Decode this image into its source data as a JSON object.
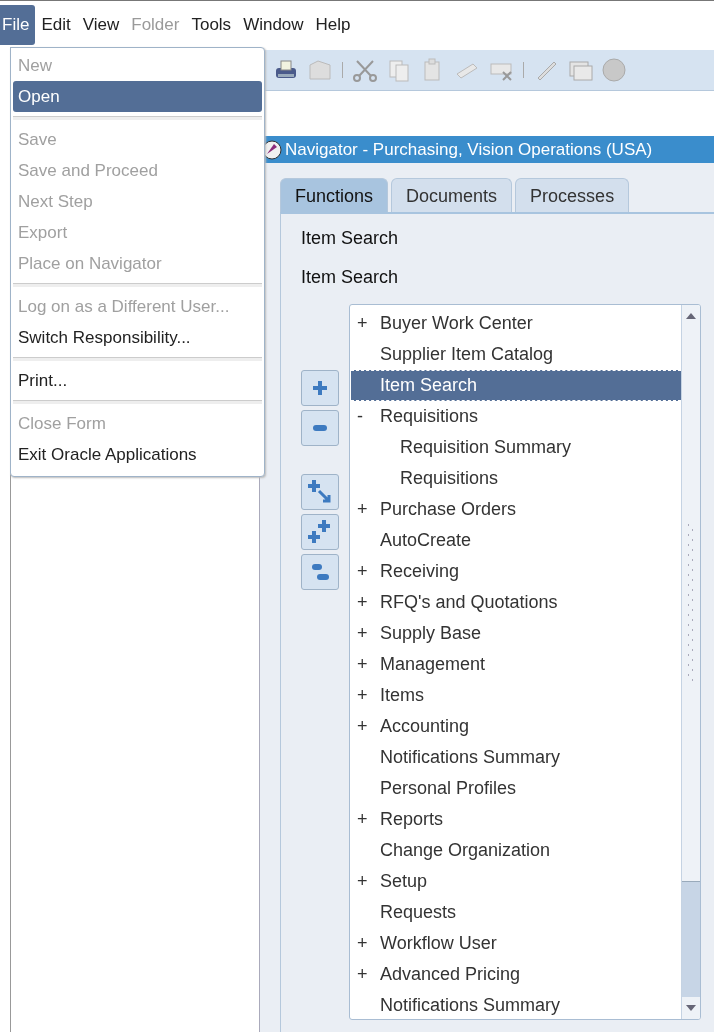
{
  "menubar": [
    {
      "label": "File",
      "selected": true,
      "disabled": false
    },
    {
      "label": "Edit",
      "selected": false,
      "disabled": false
    },
    {
      "label": "View",
      "selected": false,
      "disabled": false
    },
    {
      "label": "Folder",
      "selected": false,
      "disabled": true
    },
    {
      "label": "Tools",
      "selected": false,
      "disabled": false
    },
    {
      "label": "Window",
      "selected": false,
      "disabled": false
    },
    {
      "label": "Help",
      "selected": false,
      "disabled": false
    }
  ],
  "file_menu": {
    "groups": [
      [
        {
          "label": "New",
          "disabled": true,
          "selected": false
        },
        {
          "label": "Open",
          "disabled": false,
          "selected": true
        }
      ],
      [
        {
          "label": "Save",
          "disabled": true,
          "selected": false
        },
        {
          "label": "Save and Proceed",
          "disabled": true,
          "selected": false
        },
        {
          "label": "Next Step",
          "disabled": true,
          "selected": false
        },
        {
          "label": "Export",
          "disabled": true,
          "selected": false
        },
        {
          "label": "Place on Navigator",
          "disabled": true,
          "selected": false
        }
      ],
      [
        {
          "label": "Log on as a Different User...",
          "disabled": true,
          "selected": false
        },
        {
          "label": "Switch Responsibility...",
          "disabled": false,
          "selected": false
        }
      ],
      [
        {
          "label": "Print...",
          "disabled": false,
          "selected": false
        }
      ],
      [
        {
          "label": "Close Form",
          "disabled": true,
          "selected": false
        },
        {
          "label": "Exit Oracle Applications",
          "disabled": false,
          "selected": false
        }
      ]
    ]
  },
  "navigator": {
    "title": "Navigator - Purchasing, Vision Operations (USA)",
    "tabs": [
      {
        "label": "Functions",
        "selected": true
      },
      {
        "label": "Documents",
        "selected": false
      },
      {
        "label": "Processes",
        "selected": false
      }
    ],
    "labels": [
      "Item Search",
      "Item Search"
    ],
    "tree": [
      {
        "toggle": "+",
        "label": "Buyer Work Center",
        "selected": false
      },
      {
        "label": "Supplier Item Catalog",
        "selected": false
      },
      {
        "label": "Item Search",
        "selected": true
      },
      {
        "toggle": "-",
        "label": "Requisitions",
        "selected": false,
        "children": [
          {
            "label": "Requisition Summary",
            "selected": false
          },
          {
            "label": "Requisitions",
            "selected": false
          }
        ]
      },
      {
        "toggle": "+",
        "label": "Purchase Orders",
        "selected": false
      },
      {
        "label": "AutoCreate",
        "selected": false
      },
      {
        "toggle": "+",
        "label": "Receiving",
        "selected": false
      },
      {
        "toggle": "+",
        "label": "RFQ's and Quotations",
        "selected": false
      },
      {
        "toggle": "+",
        "label": "Supply Base",
        "selected": false
      },
      {
        "toggle": "+",
        "label": "Management",
        "selected": false
      },
      {
        "toggle": "+",
        "label": "Items",
        "selected": false
      },
      {
        "toggle": "+",
        "label": "Accounting",
        "selected": false
      },
      {
        "label": "Notifications Summary",
        "selected": false
      },
      {
        "label": "Personal Profiles",
        "selected": false
      },
      {
        "toggle": "+",
        "label": "Reports",
        "selected": false
      },
      {
        "label": "Change Organization",
        "selected": false
      },
      {
        "toggle": "+",
        "label": "Setup",
        "selected": false
      },
      {
        "label": "Requests",
        "selected": false
      },
      {
        "toggle": "+",
        "label": "Workflow User",
        "selected": false
      },
      {
        "toggle": "+",
        "label": "Advanced Pricing",
        "selected": false
      },
      {
        "label": "Notifications Summary",
        "selected": false
      }
    ]
  }
}
